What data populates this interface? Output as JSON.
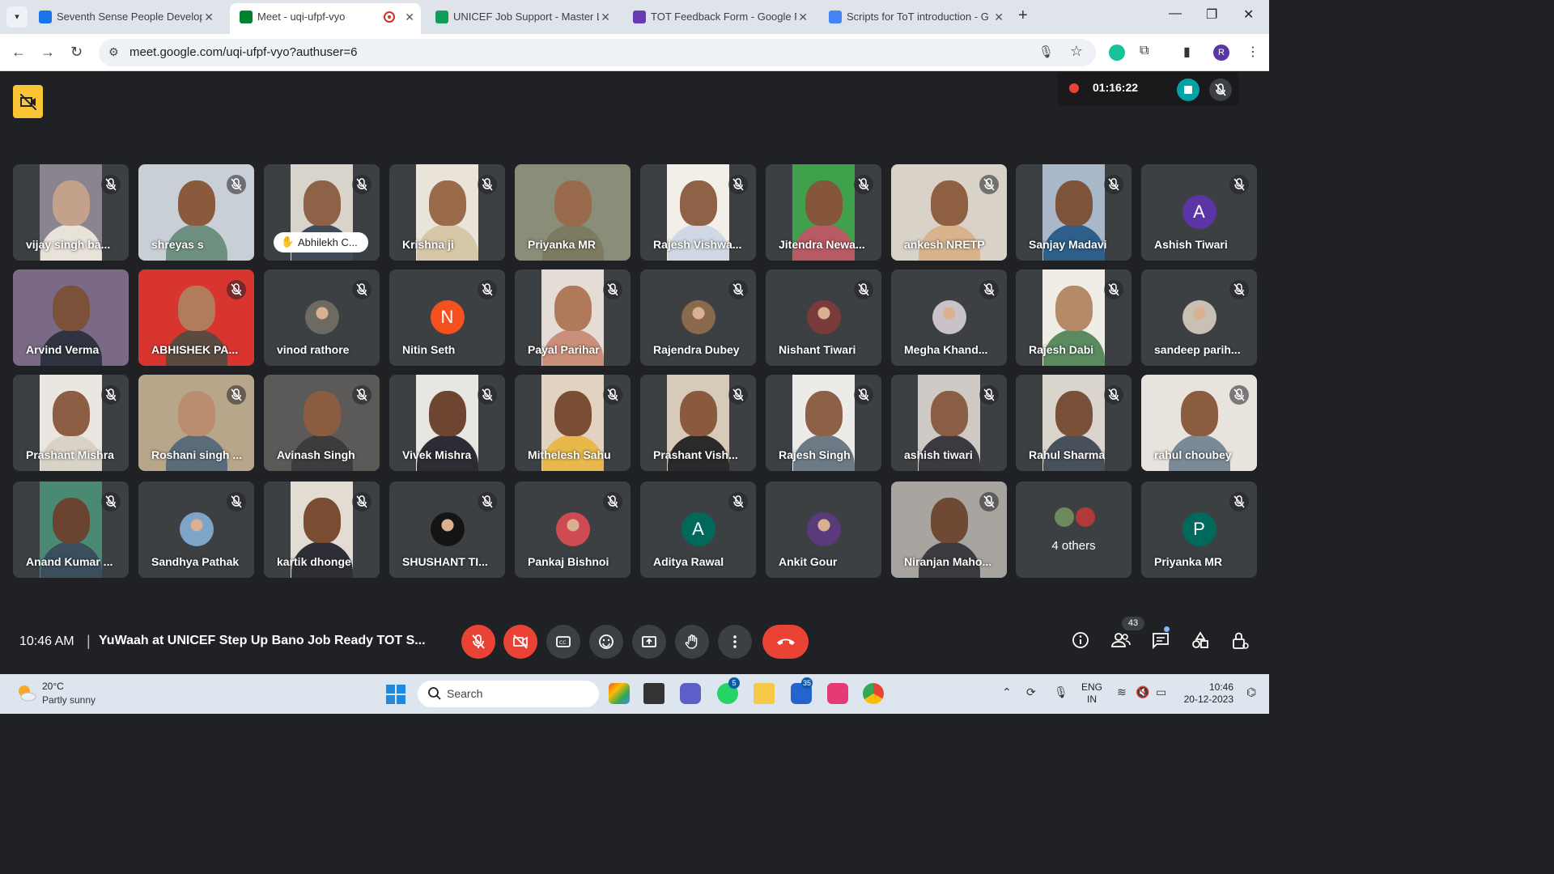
{
  "browser": {
    "tabs": [
      {
        "title": "Seventh Sense People Develop",
        "fav_color": "#1a73e8",
        "fav_text": "20",
        "active": false
      },
      {
        "title": "Meet - uqi-ufpf-vyo",
        "fav_color": "#00832d",
        "active": true,
        "recording": true
      },
      {
        "title": "UNICEF Job Support - Master Li",
        "fav_color": "#0f9d58",
        "active": false
      },
      {
        "title": "TOT Feedback Form - Google F",
        "fav_color": "#673ab7",
        "active": false
      },
      {
        "title": "Scripts for ToT introduction - G",
        "fav_color": "#4285f4",
        "active": false
      }
    ],
    "url": "meet.google.com/uqi-ufpf-vyo?authuser=6",
    "profile_initial": "R"
  },
  "meet": {
    "recording_time": "01:16:22",
    "participants": [
      {
        "name": "vijay singh ba...",
        "kind": "video",
        "bg": "#8a8490",
        "skin": "#c4a18a",
        "shirt": "#e8e2d8",
        "frame": "mid",
        "muted": true
      },
      {
        "name": "shreyas s",
        "kind": "video",
        "bg": "#c9cfd6",
        "skin": "#8a5a3c",
        "shirt": "#6e9080",
        "frame": "full",
        "muted": true
      },
      {
        "name": "Abhilekh C...",
        "kind": "video",
        "bg": "#d9d4cb",
        "skin": "#8d6247",
        "shirt": "#404b58",
        "frame": "mid",
        "muted": true,
        "hand": true
      },
      {
        "name": "Krishna ji",
        "kind": "video",
        "bg": "#e9e3da",
        "skin": "#9a6b4a",
        "shirt": "#d6c7a8",
        "frame": "mid",
        "muted": true
      },
      {
        "name": "Priyanka MR",
        "kind": "video",
        "bg": "#8a8e78",
        "skin": "#9a6a4c",
        "shirt": "#7d7a62",
        "frame": "full",
        "muted": false
      },
      {
        "name": "Rajesh Vishwa...",
        "kind": "video",
        "bg": "#f2efe9",
        "skin": "#8f6247",
        "shirt": "#cfd8e4",
        "frame": "mid",
        "muted": true
      },
      {
        "name": "Jitendra Newa...",
        "kind": "video",
        "bg": "#3fa14c",
        "skin": "#86563a",
        "shirt": "#b85a64",
        "frame": "mid",
        "muted": true
      },
      {
        "name": "ankesh NRETP",
        "kind": "video",
        "bg": "#d8d2c8",
        "skin": "#8f5f41",
        "shirt": "#d9b38c",
        "frame": "full",
        "muted": true
      },
      {
        "name": "Sanjay Madavi",
        "kind": "video",
        "bg": "#a8b8c8",
        "skin": "#7d5339",
        "shirt": "#2d5f8a",
        "frame": "mid",
        "muted": true
      },
      {
        "name": "Ashish Tiwari",
        "kind": "avatar",
        "avatar_color": "#5b35a6",
        "letter": "A",
        "muted": true
      },
      {
        "name": "Arvind Verma",
        "kind": "video",
        "bg": "#7a6a86",
        "skin": "#7b5239",
        "shirt": "#2f3440",
        "frame": "full",
        "muted": false
      },
      {
        "name": "ABHISHEK PA...",
        "kind": "video",
        "bg": "#d8352f",
        "skin": "#b07c5c",
        "shirt": "#5a4a40",
        "frame": "full",
        "muted": true
      },
      {
        "name": "vinod rathore",
        "kind": "photo",
        "photo_color": "#6d6a62",
        "muted": true
      },
      {
        "name": "Nitin Seth",
        "kind": "avatar",
        "avatar_color": "#f4511e",
        "letter": "N",
        "muted": true
      },
      {
        "name": "Payal Parihar",
        "kind": "video",
        "bg": "#e5ddd5",
        "skin": "#b07a5a",
        "shirt": "#c98f7a",
        "frame": "mid",
        "muted": true
      },
      {
        "name": "Rajendra Dubey",
        "kind": "photo",
        "photo_color": "#8a6a4c",
        "muted": true
      },
      {
        "name": "Nishant Tiwari",
        "kind": "photo",
        "photo_color": "#7a3a3a",
        "muted": true
      },
      {
        "name": "Megha Khand...",
        "kind": "photo",
        "photo_color": "#c9c2c8",
        "muted": true
      },
      {
        "name": "Rajesh Dabi",
        "kind": "video",
        "bg": "#f0ece6",
        "skin": "#b58a68",
        "shirt": "#5a8a5e",
        "frame": "mid",
        "muted": true
      },
      {
        "name": "sandeep parih...",
        "kind": "photo",
        "photo_color": "#c8c0b4",
        "muted": true
      },
      {
        "name": "Prashant Mishra",
        "kind": "video",
        "bg": "#eae6e0",
        "skin": "#8c5f44",
        "shirt": "#d9d2c6",
        "frame": "mid",
        "muted": true
      },
      {
        "name": "Roshani singh ...",
        "kind": "video",
        "bg": "#b8a68a",
        "skin": "#b98d6d",
        "shirt": "#5a6b7a",
        "frame": "full",
        "muted": true
      },
      {
        "name": "Avinash Singh",
        "kind": "video",
        "bg": "#5c5a58",
        "skin": "#8a5c40",
        "shirt": "#3c3c3c",
        "frame": "full",
        "muted": true
      },
      {
        "name": "Vivek Mishra",
        "kind": "video",
        "bg": "#e8e6e2",
        "skin": "#6e4530",
        "shirt": "#2c2c34",
        "frame": "mid",
        "muted": true
      },
      {
        "name": "Mithelesh Sahu",
        "kind": "video",
        "bg": "#e2d3c0",
        "skin": "#7a4e34",
        "shirt": "#e8b84a",
        "frame": "mid",
        "muted": true
      },
      {
        "name": "Prashant Vish...",
        "kind": "video",
        "bg": "#d6cbb8",
        "skin": "#8a5a3e",
        "shirt": "#2a2a2a",
        "frame": "mid",
        "muted": true
      },
      {
        "name": "Rajesh Singh",
        "kind": "video",
        "bg": "#ecebe8",
        "skin": "#8d6048",
        "shirt": "#6c7a86",
        "frame": "mid",
        "muted": true
      },
      {
        "name": "ashish tiwari",
        "kind": "video",
        "bg": "#cfcac6",
        "skin": "#8a5e44",
        "shirt": "#3a3a40",
        "frame": "mid",
        "muted": true
      },
      {
        "name": "Rahul Sharma",
        "kind": "video",
        "bg": "#d9d4cc",
        "skin": "#7a5038",
        "shirt": "#48505c",
        "frame": "mid",
        "muted": true
      },
      {
        "name": "rahul choubey",
        "kind": "video",
        "bg": "#e8e3dc",
        "skin": "#8a5c40",
        "shirt": "#7a8a96",
        "frame": "full",
        "muted": true
      },
      {
        "name": "Anand Kumar ...",
        "kind": "video",
        "bg": "#4a8a72",
        "skin": "#6a4430",
        "shirt": "#3a4e5e",
        "frame": "mid",
        "muted": true
      },
      {
        "name": "Sandhya Pathak",
        "kind": "photo",
        "photo_color": "#7ea4c8",
        "muted": true
      },
      {
        "name": "kartik dhonge",
        "kind": "video",
        "bg": "#e2dcd2",
        "skin": "#7a4c32",
        "shirt": "#2e2e36",
        "frame": "mid",
        "muted": true
      },
      {
        "name": "SHUSHANT TI...",
        "kind": "photo",
        "photo_color": "#141414",
        "muted": true
      },
      {
        "name": "Pankaj Bishnoi",
        "kind": "photo",
        "photo_color": "#d04a54",
        "muted": true
      },
      {
        "name": "Aditya Rawal",
        "kind": "avatar",
        "avatar_color": "#00695c",
        "letter": "A",
        "muted": true
      },
      {
        "name": "Ankit Gour",
        "kind": "photo",
        "photo_color": "#5a3a7a",
        "muted": false
      },
      {
        "name": "Niranjan Maho...",
        "kind": "video",
        "bg": "#a8a4a0",
        "skin": "#6e4a34",
        "shirt": "#3c3c40",
        "frame": "full",
        "muted": true
      },
      {
        "name": "4 others",
        "kind": "others",
        "muted": false
      },
      {
        "name": "Priyanka MR",
        "kind": "avatar",
        "avatar_color": "#00695c",
        "letter": "P",
        "muted": true
      }
    ],
    "clock": "10:46 AM",
    "separator": "|",
    "title": "YuWaah at UNICEF Step Up Bano Job Ready TOT S...",
    "people_count": "43"
  },
  "taskbar": {
    "temperature": "20°C",
    "weather": "Partly sunny",
    "search_label": "Search",
    "whatsapp_badge": "5",
    "todo_badge": "35",
    "lang_line1": "ENG",
    "lang_line2": "IN",
    "time": "10:46",
    "date": "20-12-2023"
  }
}
